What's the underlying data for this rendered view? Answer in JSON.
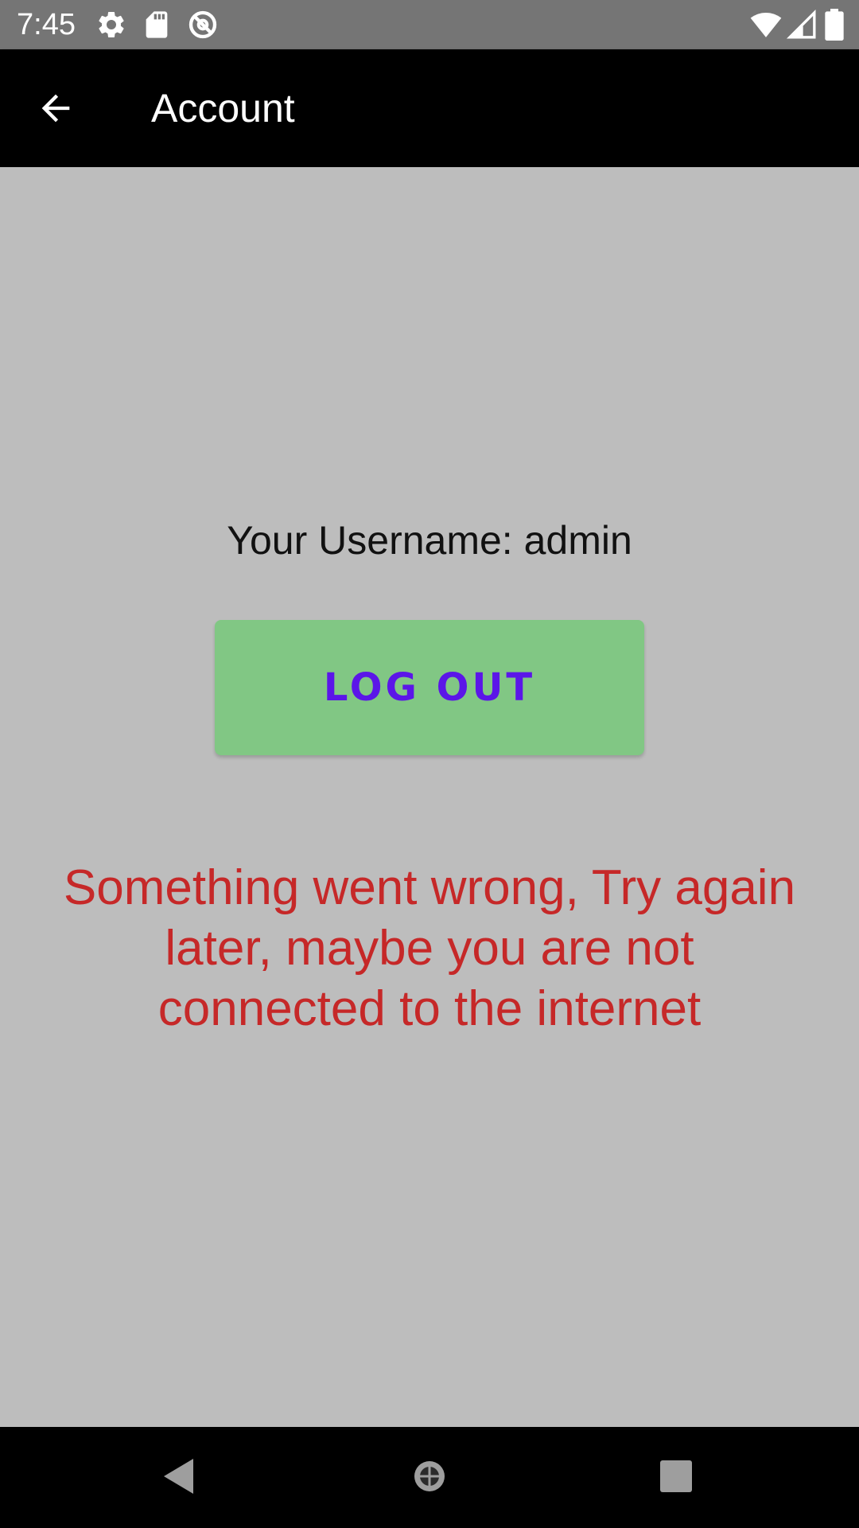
{
  "status_bar": {
    "time": "7:45",
    "left_icons": [
      "gear-icon",
      "sd-card-icon",
      "no-sync-icon"
    ],
    "right_icons": [
      "wifi-icon",
      "cell-signal-icon",
      "battery-icon"
    ]
  },
  "app_bar": {
    "title": "Account",
    "back_icon": "arrow-back-icon"
  },
  "main": {
    "username_text": "Your Username: admin",
    "logout_label": "LOG OUT",
    "error_message": "Something went wrong, Try again later, maybe you are not connected to the internet"
  },
  "nav_bar": {
    "icons": [
      "back-triangle-icon",
      "home-icon",
      "recents-square-icon"
    ]
  },
  "colors": {
    "status_bar": "#757575",
    "app_bar": "#000000",
    "background": "#bdbdbd",
    "button": "#81c784",
    "button_text": "#5b16e8",
    "error_text": "#c62828"
  }
}
